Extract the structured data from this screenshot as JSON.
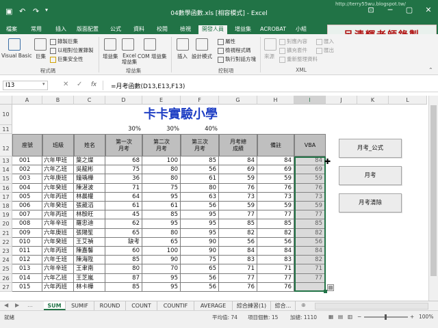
{
  "window": {
    "title": "04數學函數.xls [相容模式] - Excel",
    "qat_icons": [
      "save-icon",
      "undo-icon",
      "redo-icon",
      "customize-icon"
    ],
    "controls": [
      "⊡",
      "─",
      "▢",
      "✕"
    ]
  },
  "ribbon_tabs": [
    "檔案",
    "常用",
    "插入",
    "版面配置",
    "公式",
    "資料",
    "校閱",
    "檢視",
    "開發人員",
    "增益集",
    "ACROBAT",
    "小組"
  ],
  "active_tab": "開發人員",
  "watermark": "呂清輝老師錄製",
  "watermark_url": "http://terry55wu.blogspot.tw/",
  "ribbon": {
    "code_group": {
      "label": "程式碼",
      "visual_basic": "Visual Basic",
      "macros": "巨集",
      "record_macro": "錄製巨集",
      "relative_ref": "以相對位置錄製",
      "macro_security": "巨集安全性"
    },
    "addins_group": {
      "label": "增益集",
      "addins": "增益集",
      "excel_addins": "Excel 增益集",
      "com_addins": "COM 增益集"
    },
    "controls_group": {
      "label": "控制項",
      "insert": "插入",
      "design_mode": "設計模式",
      "properties": "屬性",
      "view_code": "檢視程式碼",
      "run_dialog": "執行對話方塊"
    },
    "xml_group": {
      "label": "XML",
      "source": "來源",
      "map_properties": "對應內容",
      "expansion_packs": "擴充套件",
      "refresh_data": "重新整理資料",
      "import": "匯入",
      "export": "匯出"
    }
  },
  "formula_bar": {
    "name_box": "I13",
    "fx_label": "fx",
    "formula": "=月考函數(D13,E13,F13)"
  },
  "columns": [
    "A",
    "B",
    "C",
    "D",
    "E",
    "F",
    "G",
    "H",
    "I",
    "J",
    "K",
    "L"
  ],
  "sheet": {
    "title": "卡卡實驗小學",
    "title_color": "#1f3fc4",
    "weights": [
      "30%",
      "30%",
      "40%"
    ],
    "headers": [
      "座號",
      "班級",
      "姓名",
      "第一次月考",
      "第二次月考",
      "第三次月考",
      "月考總成績",
      "備註",
      "VBA"
    ],
    "rows": [
      {
        "row": "13",
        "id": "001",
        "class": "六年甲班",
        "name": "葉之燦",
        "m1": "68",
        "m2": "100",
        "m3": "85",
        "total": "84",
        "note": "84",
        "vba": "84"
      },
      {
        "row": "14",
        "id": "002",
        "class": "六年乙班",
        "name": "吳龍彬",
        "m1": "75",
        "m2": "80",
        "m3": "56",
        "total": "69",
        "note": "69",
        "vba": "69"
      },
      {
        "row": "15",
        "id": "003",
        "class": "六年庚班",
        "name": "鐘瑀樺",
        "m1": "36",
        "m2": "80",
        "m3": "61",
        "total": "59",
        "note": "59",
        "vba": "59"
      },
      {
        "row": "16",
        "id": "004",
        "class": "六年癸班",
        "name": "陳湛波",
        "m1": "71",
        "m2": "75",
        "m3": "80",
        "total": "76",
        "note": "76",
        "vba": "76"
      },
      {
        "row": "17",
        "id": "005",
        "class": "六年丙班",
        "name": "林晨權",
        "m1": "64",
        "m2": "95",
        "m3": "63",
        "total": "73",
        "note": "73",
        "vba": "73"
      },
      {
        "row": "18",
        "id": "006",
        "class": "六年癸班",
        "name": "張葳滔",
        "m1": "61",
        "m2": "61",
        "m3": "56",
        "total": "59",
        "note": "59",
        "vba": "59"
      },
      {
        "row": "19",
        "id": "007",
        "class": "六年丙班",
        "name": "林殷旺",
        "m1": "45",
        "m2": "85",
        "m3": "95",
        "total": "77",
        "note": "77",
        "vba": "77"
      },
      {
        "row": "20",
        "id": "008",
        "class": "六年辛班",
        "name": "羅忠迪",
        "m1": "62",
        "m2": "95",
        "m3": "95",
        "total": "85",
        "note": "85",
        "vba": "85"
      },
      {
        "row": "21",
        "id": "009",
        "class": "六年庚班",
        "name": "張陽笙",
        "m1": "65",
        "m2": "80",
        "m3": "95",
        "total": "82",
        "note": "82",
        "vba": "82"
      },
      {
        "row": "22",
        "id": "010",
        "class": "六年癸班",
        "name": "王艾禎",
        "m1": "缺考",
        "m2": "65",
        "m3": "90",
        "total": "56",
        "note": "56",
        "vba": "56"
      },
      {
        "row": "23",
        "id": "011",
        "class": "六年丙班",
        "name": "陳嘉馨",
        "m1": "60",
        "m2": "100",
        "m3": "90",
        "total": "84",
        "note": "84",
        "vba": "84"
      },
      {
        "row": "24",
        "id": "012",
        "class": "六年壬班",
        "name": "陳海陞",
        "m1": "85",
        "m2": "90",
        "m3": "75",
        "total": "83",
        "note": "83",
        "vba": "82"
      },
      {
        "row": "25",
        "id": "013",
        "class": "六年辛班",
        "name": "王聿南",
        "m1": "80",
        "m2": "70",
        "m3": "65",
        "total": "71",
        "note": "71",
        "vba": "71"
      },
      {
        "row": "26",
        "id": "014",
        "class": "六年乙班",
        "name": "王芝嵐",
        "m1": "87",
        "m2": "95",
        "m3": "56",
        "total": "77",
        "note": "77",
        "vba": "77"
      },
      {
        "row": "27",
        "id": "015",
        "class": "六年丙班",
        "name": "林卡樺",
        "m1": "85",
        "m2": "95",
        "m3": "56",
        "total": "76",
        "note": "76",
        "vba": ""
      }
    ]
  },
  "buttons": {
    "exam_formula": "月考_公式",
    "exam": "月考",
    "exam_clear": "月考清除"
  },
  "sheet_tabs": [
    "SUM",
    "SUMIF",
    "ROUND",
    "COUNT",
    "COUNTIF",
    "AVERAGE",
    "綜合練習(1)",
    "綜合..."
  ],
  "active_sheet": "SUM",
  "status": {
    "ready": "就緒",
    "average": "平均值: 74",
    "count": "項目個數: 15",
    "sum": "加總: 1110",
    "zoom": "100%"
  }
}
